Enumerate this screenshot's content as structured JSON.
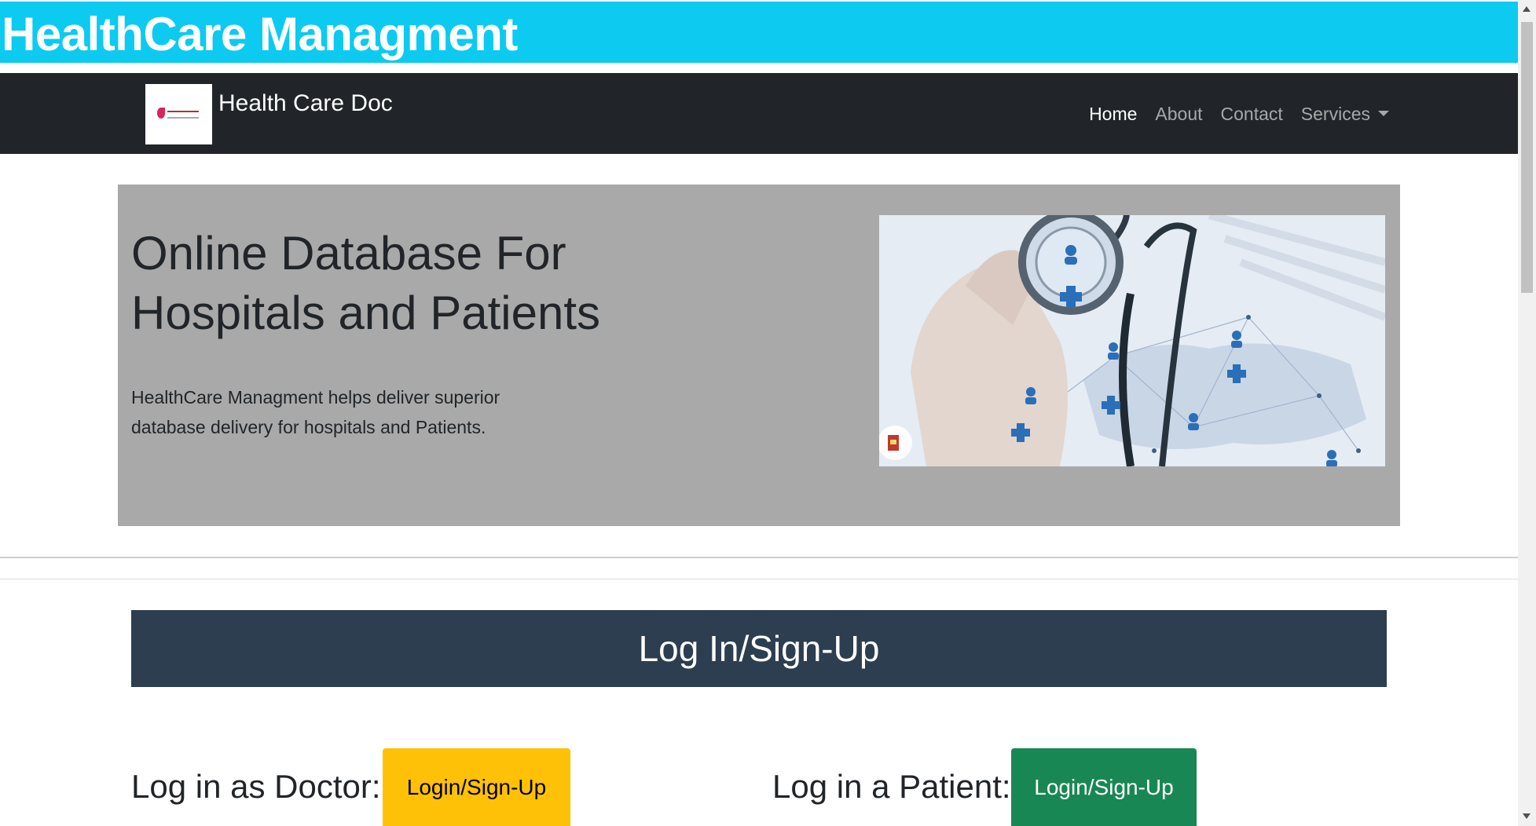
{
  "banner": {
    "title": "HealthCare Managment"
  },
  "navbar": {
    "brand_name": "Health Care Doc",
    "links": [
      {
        "label": "Home",
        "active": true
      },
      {
        "label": "About",
        "active": false
      },
      {
        "label": "Contact",
        "active": false
      },
      {
        "label": "Services",
        "active": false,
        "dropdown": true
      }
    ]
  },
  "hero": {
    "title_line1": "Online Database For",
    "title_line2": "Hospitals and Patients",
    "desc_line1": "HealthCare Managment helps deliver superior",
    "desc_line2": "database delivery for hospitals and Patients."
  },
  "login": {
    "header": "Log In/Sign-Up",
    "doctor_label": "Log in as Doctor:",
    "doctor_button": "Login/Sign-Up",
    "patient_label": "Log in a Patient:",
    "patient_button": "Login/Sign-Up"
  },
  "colors": {
    "banner": "#0dcaf0",
    "navbar": "#212529",
    "hero_bg": "#a9a9a9",
    "login_header": "#2c3e50",
    "doctor_button": "#ffc107",
    "patient_button": "#198754"
  }
}
